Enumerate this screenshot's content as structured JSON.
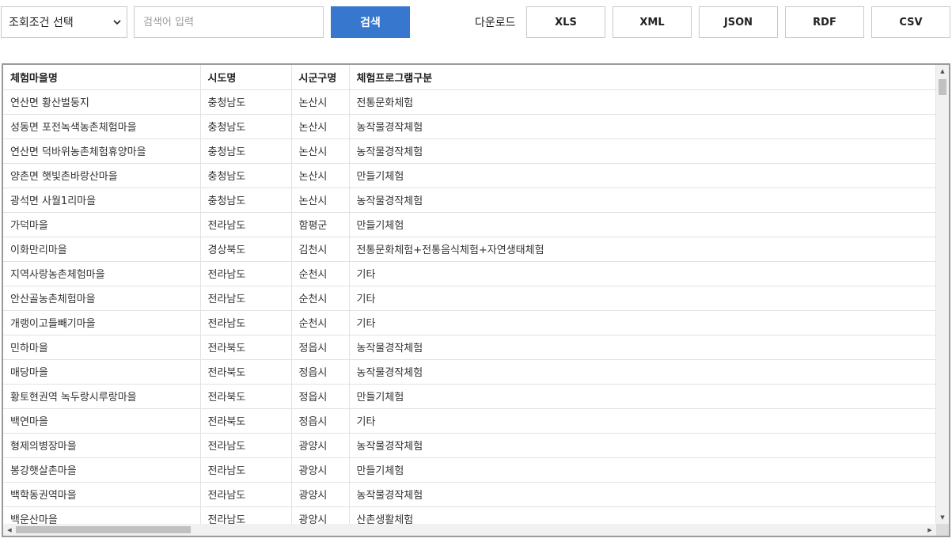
{
  "search": {
    "condition_select": "조회조건 선택",
    "input_placeholder": "검색어 입력",
    "input_value": "",
    "button_label": "검색"
  },
  "download": {
    "label": "다운로드",
    "formats": [
      "XLS",
      "XML",
      "JSON",
      "RDF",
      "CSV"
    ]
  },
  "table": {
    "headers": [
      "체험마을명",
      "시도명",
      "시군구명",
      "체험프로그램구분"
    ],
    "rows": [
      [
        "연산면 황산벌둥지",
        "충청남도",
        "논산시",
        "전통문화체험"
      ],
      [
        "성동면 포전녹색농촌체험마을",
        "충청남도",
        "논산시",
        "농작물경작체험"
      ],
      [
        "연산면 덕바위농촌체험휴양마을",
        "충청남도",
        "논산시",
        "농작물경작체험"
      ],
      [
        "양촌면 햇빛촌바랑산마을",
        "충청남도",
        "논산시",
        "만들기체험"
      ],
      [
        "광석면 사월1리마을",
        "충청남도",
        "논산시",
        "농작물경작체험"
      ],
      [
        "가덕마을",
        "전라남도",
        "함평군",
        "만들기체험"
      ],
      [
        "이화만리마을",
        "경상북도",
        "김천시",
        "전통문화체험+전통음식체험+자연생태체험"
      ],
      [
        "지역사랑농촌체험마을",
        "전라남도",
        "순천시",
        "기타"
      ],
      [
        "안산골농촌체험마을",
        "전라남도",
        "순천시",
        "기타"
      ],
      [
        "개랭이고들빼기마을",
        "전라남도",
        "순천시",
        "기타"
      ],
      [
        "민하마을",
        "전라북도",
        "정읍시",
        "농작물경작체험"
      ],
      [
        "매당마을",
        "전라북도",
        "정읍시",
        "농작물경작체험"
      ],
      [
        "황토현권역 녹두랑시루랑마을",
        "전라북도",
        "정읍시",
        "만들기체험"
      ],
      [
        "백연마을",
        "전라북도",
        "정읍시",
        "기타"
      ],
      [
        "형제의병장마을",
        "전라남도",
        "광양시",
        "농작물경작체험"
      ],
      [
        "봉강햇살촌마을",
        "전라남도",
        "광양시",
        "만들기체험"
      ],
      [
        "백학동권역마을",
        "전라남도",
        "광양시",
        "농작물경작체험"
      ],
      [
        "백운산마을",
        "전라남도",
        "광양시",
        "산촌생활체험"
      ]
    ]
  },
  "icons": {
    "select_chevron": "chevron-down-icon",
    "scroll_up": "arrow-up-icon",
    "scroll_down": "arrow-down-icon",
    "scroll_left": "arrow-left-icon",
    "scroll_right": "arrow-right-icon"
  },
  "colors": {
    "search_button": "#3777ce",
    "grid_border": "#9a9a9a"
  }
}
